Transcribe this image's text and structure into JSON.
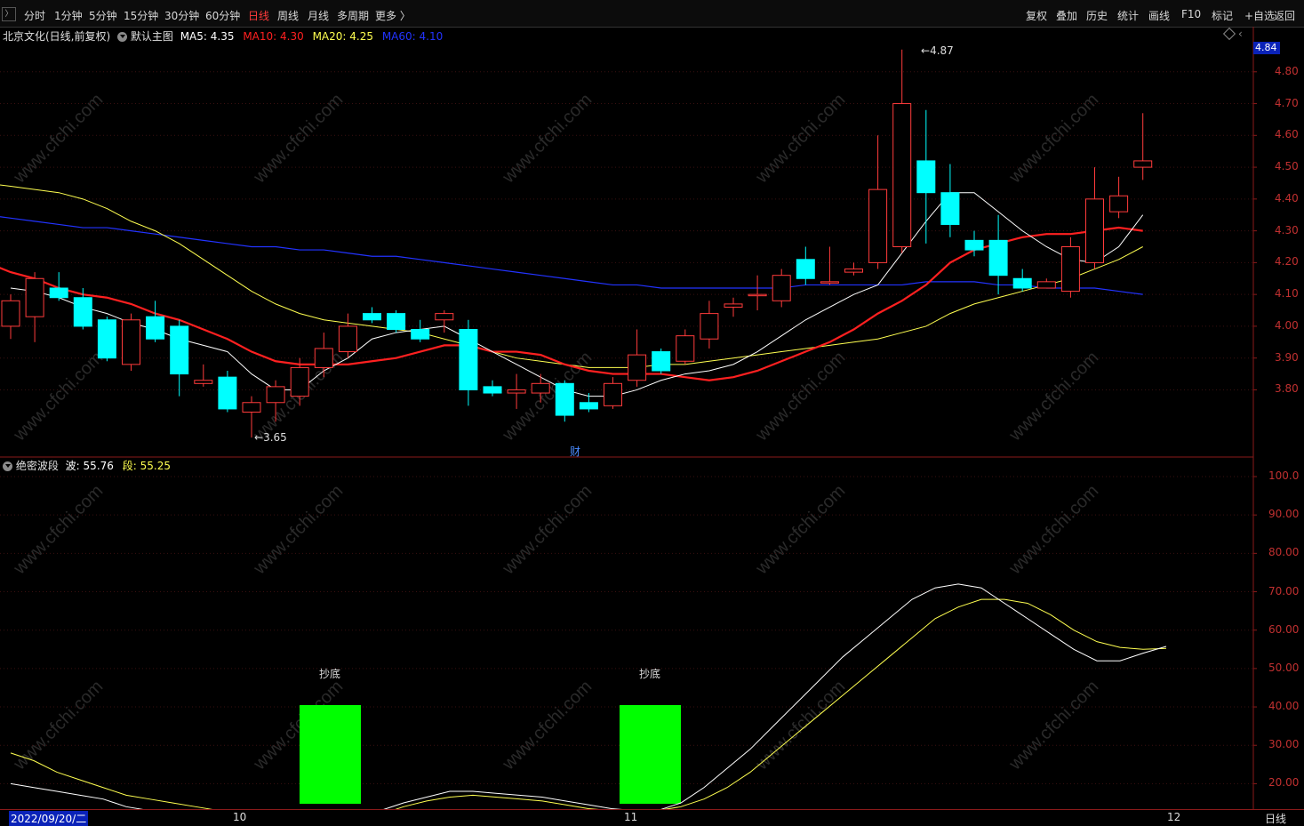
{
  "toolbar": {
    "periods": [
      "分时",
      "1分钟",
      "5分钟",
      "15分钟",
      "30分钟",
      "60分钟",
      "日线",
      "周线",
      "月线",
      "多周期",
      "更多 〉"
    ],
    "active": "日线",
    "right": [
      "复权",
      "叠加",
      "历史",
      "统计",
      "画线",
      "F10",
      "标记",
      "+自选",
      "返回"
    ]
  },
  "header": {
    "title": "北京文化(日线,前复权)",
    "template": "默认主图",
    "ma5_label": "MA5:",
    "ma5": "4.35",
    "ma10_label": "MA10:",
    "ma10": "4.30",
    "ma20_label": "MA20:",
    "ma20": "4.25",
    "ma60_label": "MA60:",
    "ma60": "4.10"
  },
  "price_axis": {
    "last_price": "4.84",
    "ticks": [
      "4.80",
      "4.70",
      "4.60",
      "4.50",
      "4.40",
      "4.30",
      "4.20",
      "4.10",
      "4.00",
      "3.90",
      "3.80"
    ]
  },
  "annotations": {
    "high": "4.87",
    "low": "3.65",
    "fin_marker": "财"
  },
  "indicator": {
    "name": "绝密波段",
    "wave_label": "波:",
    "wave": "55.76",
    "seg_label": "段:",
    "seg": "55.25",
    "ticks": [
      "100.0",
      "90.00",
      "80.00",
      "70.00",
      "60.00",
      "50.00",
      "40.00",
      "30.00",
      "20.00"
    ],
    "signals": [
      "抄底",
      "抄底"
    ]
  },
  "date_axis": {
    "start": "2022/09/20/二",
    "months": [
      "10",
      "11",
      "12"
    ],
    "period": "日线"
  },
  "watermark": "www.cfchi.com",
  "colors": {
    "up": "#ff3b3b",
    "down": "#00ffff",
    "ma5": "#ffffff",
    "ma10": "#ff2020",
    "ma20": "#ffff50",
    "ma60": "#2233ff",
    "signal": "#00ff00"
  },
  "chart_data": {
    "type": "candlestick",
    "price_range": [
      3.6,
      4.9
    ],
    "candles": [
      [
        4.0,
        4.08,
        4.1,
        3.96
      ],
      [
        4.03,
        4.15,
        4.17,
        3.95
      ],
      [
        4.12,
        4.09,
        4.17,
        4.08
      ],
      [
        4.09,
        4.0,
        4.12,
        3.99
      ],
      [
        4.02,
        3.9,
        4.03,
        3.89
      ],
      [
        3.88,
        4.02,
        4.04,
        3.86
      ],
      [
        4.03,
        3.96,
        4.08,
        3.95
      ],
      [
        4.0,
        3.85,
        4.02,
        3.78
      ],
      [
        3.82,
        3.83,
        3.88,
        3.81
      ],
      [
        3.84,
        3.74,
        3.86,
        3.73
      ],
      [
        3.73,
        3.76,
        3.78,
        3.65
      ],
      [
        3.76,
        3.81,
        3.83,
        3.7
      ],
      [
        3.78,
        3.87,
        3.9,
        3.75
      ],
      [
        3.87,
        3.93,
        3.98,
        3.84
      ],
      [
        3.92,
        4.0,
        4.04,
        3.9
      ],
      [
        4.04,
        4.02,
        4.06,
        4.01
      ],
      [
        4.04,
        3.99,
        4.05,
        3.98
      ],
      [
        3.99,
        3.96,
        4.02,
        3.95
      ],
      [
        4.02,
        4.04,
        4.05,
        3.98
      ],
      [
        3.99,
        3.8,
        4.02,
        3.75
      ],
      [
        3.81,
        3.79,
        3.83,
        3.78
      ],
      [
        3.79,
        3.8,
        3.85,
        3.74
      ],
      [
        3.79,
        3.82,
        3.85,
        3.76
      ],
      [
        3.82,
        3.72,
        3.83,
        3.7
      ],
      [
        3.76,
        3.74,
        3.79,
        3.73
      ],
      [
        3.75,
        3.82,
        3.84,
        3.74
      ],
      [
        3.83,
        3.91,
        3.99,
        3.81
      ],
      [
        3.92,
        3.86,
        3.93,
        3.85
      ],
      [
        3.89,
        3.97,
        3.99,
        3.88
      ],
      [
        3.96,
        4.04,
        4.08,
        3.93
      ],
      [
        4.06,
        4.07,
        4.09,
        4.03
      ],
      [
        4.1,
        4.1,
        4.16,
        4.05
      ],
      [
        4.08,
        4.16,
        4.18,
        4.06
      ],
      [
        4.21,
        4.15,
        4.25,
        4.13
      ],
      [
        4.14,
        4.14,
        4.25,
        4.13
      ],
      [
        4.17,
        4.18,
        4.2,
        4.16
      ],
      [
        4.2,
        4.43,
        4.6,
        4.18
      ],
      [
        4.25,
        4.7,
        4.87,
        4.23
      ],
      [
        4.52,
        4.42,
        4.68,
        4.26
      ],
      [
        4.42,
        4.32,
        4.51,
        4.28
      ],
      [
        4.27,
        4.24,
        4.3,
        4.22
      ],
      [
        4.27,
        4.16,
        4.35,
        4.1
      ],
      [
        4.15,
        4.12,
        4.18,
        4.11
      ],
      [
        4.12,
        4.14,
        4.15,
        4.12
      ],
      [
        4.11,
        4.25,
        4.28,
        4.09
      ],
      [
        4.2,
        4.4,
        4.5,
        4.18
      ],
      [
        4.36,
        4.41,
        4.47,
        4.34
      ],
      [
        4.5,
        4.52,
        4.67,
        4.46
      ]
    ],
    "ma5": [
      4.12,
      4.11,
      4.09,
      4.06,
      4.04,
      4.01,
      3.99,
      3.96,
      3.94,
      3.92,
      3.85,
      3.8,
      3.8,
      3.86,
      3.9,
      3.96,
      3.98,
      3.99,
      4.0,
      3.96,
      3.92,
      3.88,
      3.84,
      3.8,
      3.78,
      3.78,
      3.8,
      3.83,
      3.85,
      3.86,
      3.88,
      3.92,
      3.97,
      4.02,
      4.06,
      4.1,
      4.13,
      4.23,
      4.33,
      4.42,
      4.42,
      4.36,
      4.3,
      4.25,
      4.21,
      4.2,
      4.25,
      4.35
    ],
    "ma10": [
      4.2,
      4.17,
      4.15,
      4.12,
      4.1,
      4.09,
      4.07,
      4.04,
      4.02,
      3.99,
      3.96,
      3.92,
      3.89,
      3.88,
      3.88,
      3.88,
      3.89,
      3.9,
      3.92,
      3.94,
      3.94,
      3.92,
      3.92,
      3.91,
      3.88,
      3.86,
      3.85,
      3.85,
      3.85,
      3.84,
      3.83,
      3.84,
      3.86,
      3.89,
      3.92,
      3.95,
      3.99,
      4.04,
      4.08,
      4.13,
      4.2,
      4.24,
      4.26,
      4.28,
      4.29,
      4.29,
      4.3,
      4.31,
      4.3
    ],
    "ma20": [
      4.45,
      4.44,
      4.43,
      4.42,
      4.4,
      4.37,
      4.33,
      4.3,
      4.26,
      4.21,
      4.16,
      4.11,
      4.07,
      4.04,
      4.02,
      4.01,
      4.0,
      3.99,
      3.98,
      3.96,
      3.94,
      3.92,
      3.9,
      3.89,
      3.88,
      3.87,
      3.87,
      3.87,
      3.88,
      3.88,
      3.89,
      3.9,
      3.91,
      3.92,
      3.93,
      3.94,
      3.95,
      3.96,
      3.98,
      4.0,
      4.04,
      4.07,
      4.09,
      4.11,
      4.13,
      4.15,
      4.18,
      4.21,
      4.25
    ],
    "ma60": [
      4.35,
      4.34,
      4.33,
      4.32,
      4.31,
      4.31,
      4.3,
      4.29,
      4.28,
      4.27,
      4.26,
      4.25,
      4.25,
      4.24,
      4.24,
      4.23,
      4.22,
      4.22,
      4.21,
      4.2,
      4.19,
      4.18,
      4.17,
      4.16,
      4.15,
      4.14,
      4.13,
      4.13,
      4.12,
      4.12,
      4.12,
      4.12,
      4.12,
      4.12,
      4.13,
      4.13,
      4.13,
      4.13,
      4.13,
      4.14,
      4.14,
      4.14,
      4.13,
      4.13,
      4.12,
      4.12,
      4.12,
      4.11,
      4.1
    ],
    "wave": [
      20,
      19,
      18,
      17,
      16,
      14,
      13,
      12,
      11.5,
      11,
      10.5,
      10,
      9.5,
      9,
      9,
      10,
      13,
      15,
      16.5,
      18,
      18,
      17.5,
      17,
      16.5,
      15.5,
      14.5,
      13.5,
      13,
      13,
      15,
      19,
      24,
      29,
      35,
      41,
      47,
      53,
      58,
      63,
      68,
      71,
      72,
      71,
      67,
      63,
      59,
      55,
      52,
      52,
      54,
      55.76
    ],
    "seg": [
      28,
      26,
      23,
      21,
      19,
      17,
      16,
      15,
      14,
      13,
      12,
      11,
      10.5,
      10,
      10,
      10.5,
      12,
      14,
      15.5,
      16.5,
      17,
      16.5,
      16,
      15.5,
      14.5,
      13.5,
      13,
      13,
      13,
      14,
      16,
      19,
      23,
      28,
      33,
      38,
      43,
      48,
      53,
      58,
      63,
      66,
      68,
      68,
      67,
      64,
      60,
      57,
      55.5,
      55,
      55.25
    ],
    "signals_at": [
      12,
      24
    ]
  }
}
